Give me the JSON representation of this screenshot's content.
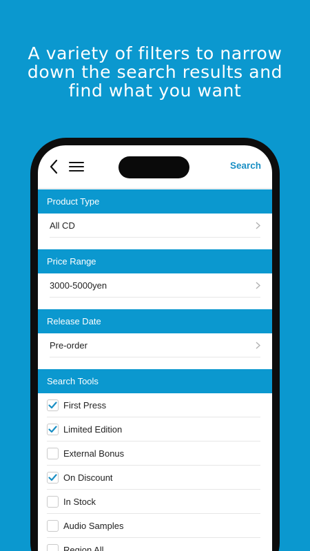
{
  "headline": {
    "line1": "A variety of filters to narrow",
    "line2": "down the search results and",
    "line3": "find what you want"
  },
  "nav": {
    "back_icon": "chevron-left-icon",
    "menu_icon": "hamburger-menu-icon",
    "search_label": "Search"
  },
  "sections": {
    "product_type": {
      "title": "Product Type",
      "value": "All CD"
    },
    "price_range": {
      "title": "Price Range",
      "value": "3000-5000yen"
    },
    "release_date": {
      "title": "Release Date",
      "value": "Pre-order"
    },
    "search_tools": {
      "title": "Search Tools",
      "items": [
        {
          "label": "First Press",
          "checked": true
        },
        {
          "label": "Limited Edition",
          "checked": true
        },
        {
          "label": "External Bonus",
          "checked": false
        },
        {
          "label": "On Discount",
          "checked": true
        },
        {
          "label": "In Stock",
          "checked": false
        },
        {
          "label": "Audio Samples",
          "checked": false
        },
        {
          "label": "Region All",
          "checked": false
        }
      ]
    }
  },
  "colors": {
    "background": "#0b98cf",
    "section_header": "#0b98cf",
    "accent": "#1a8fc4",
    "check": "#1a8fc4"
  }
}
